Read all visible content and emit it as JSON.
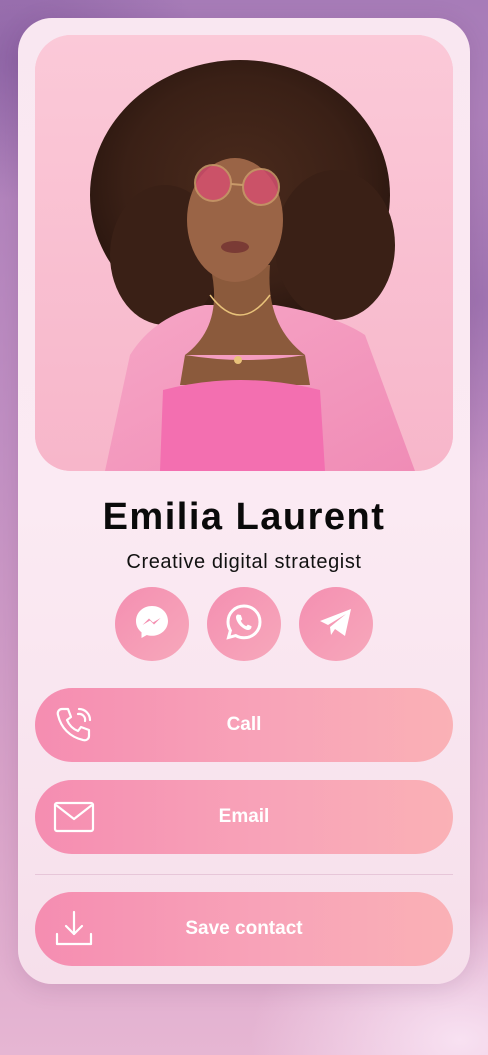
{
  "profile": {
    "name": "Emilia Laurent",
    "title": "Creative digital strategist"
  },
  "socials": [
    {
      "icon": "messenger-icon"
    },
    {
      "icon": "whatsapp-icon"
    },
    {
      "icon": "telegram-icon"
    }
  ],
  "actions": {
    "call_label": "Call",
    "email_label": "Email",
    "save_label": "Save contact"
  },
  "colors": {
    "accent": "#f58db1",
    "accent_end": "#fab1b6",
    "card": "#fbeaf3"
  }
}
